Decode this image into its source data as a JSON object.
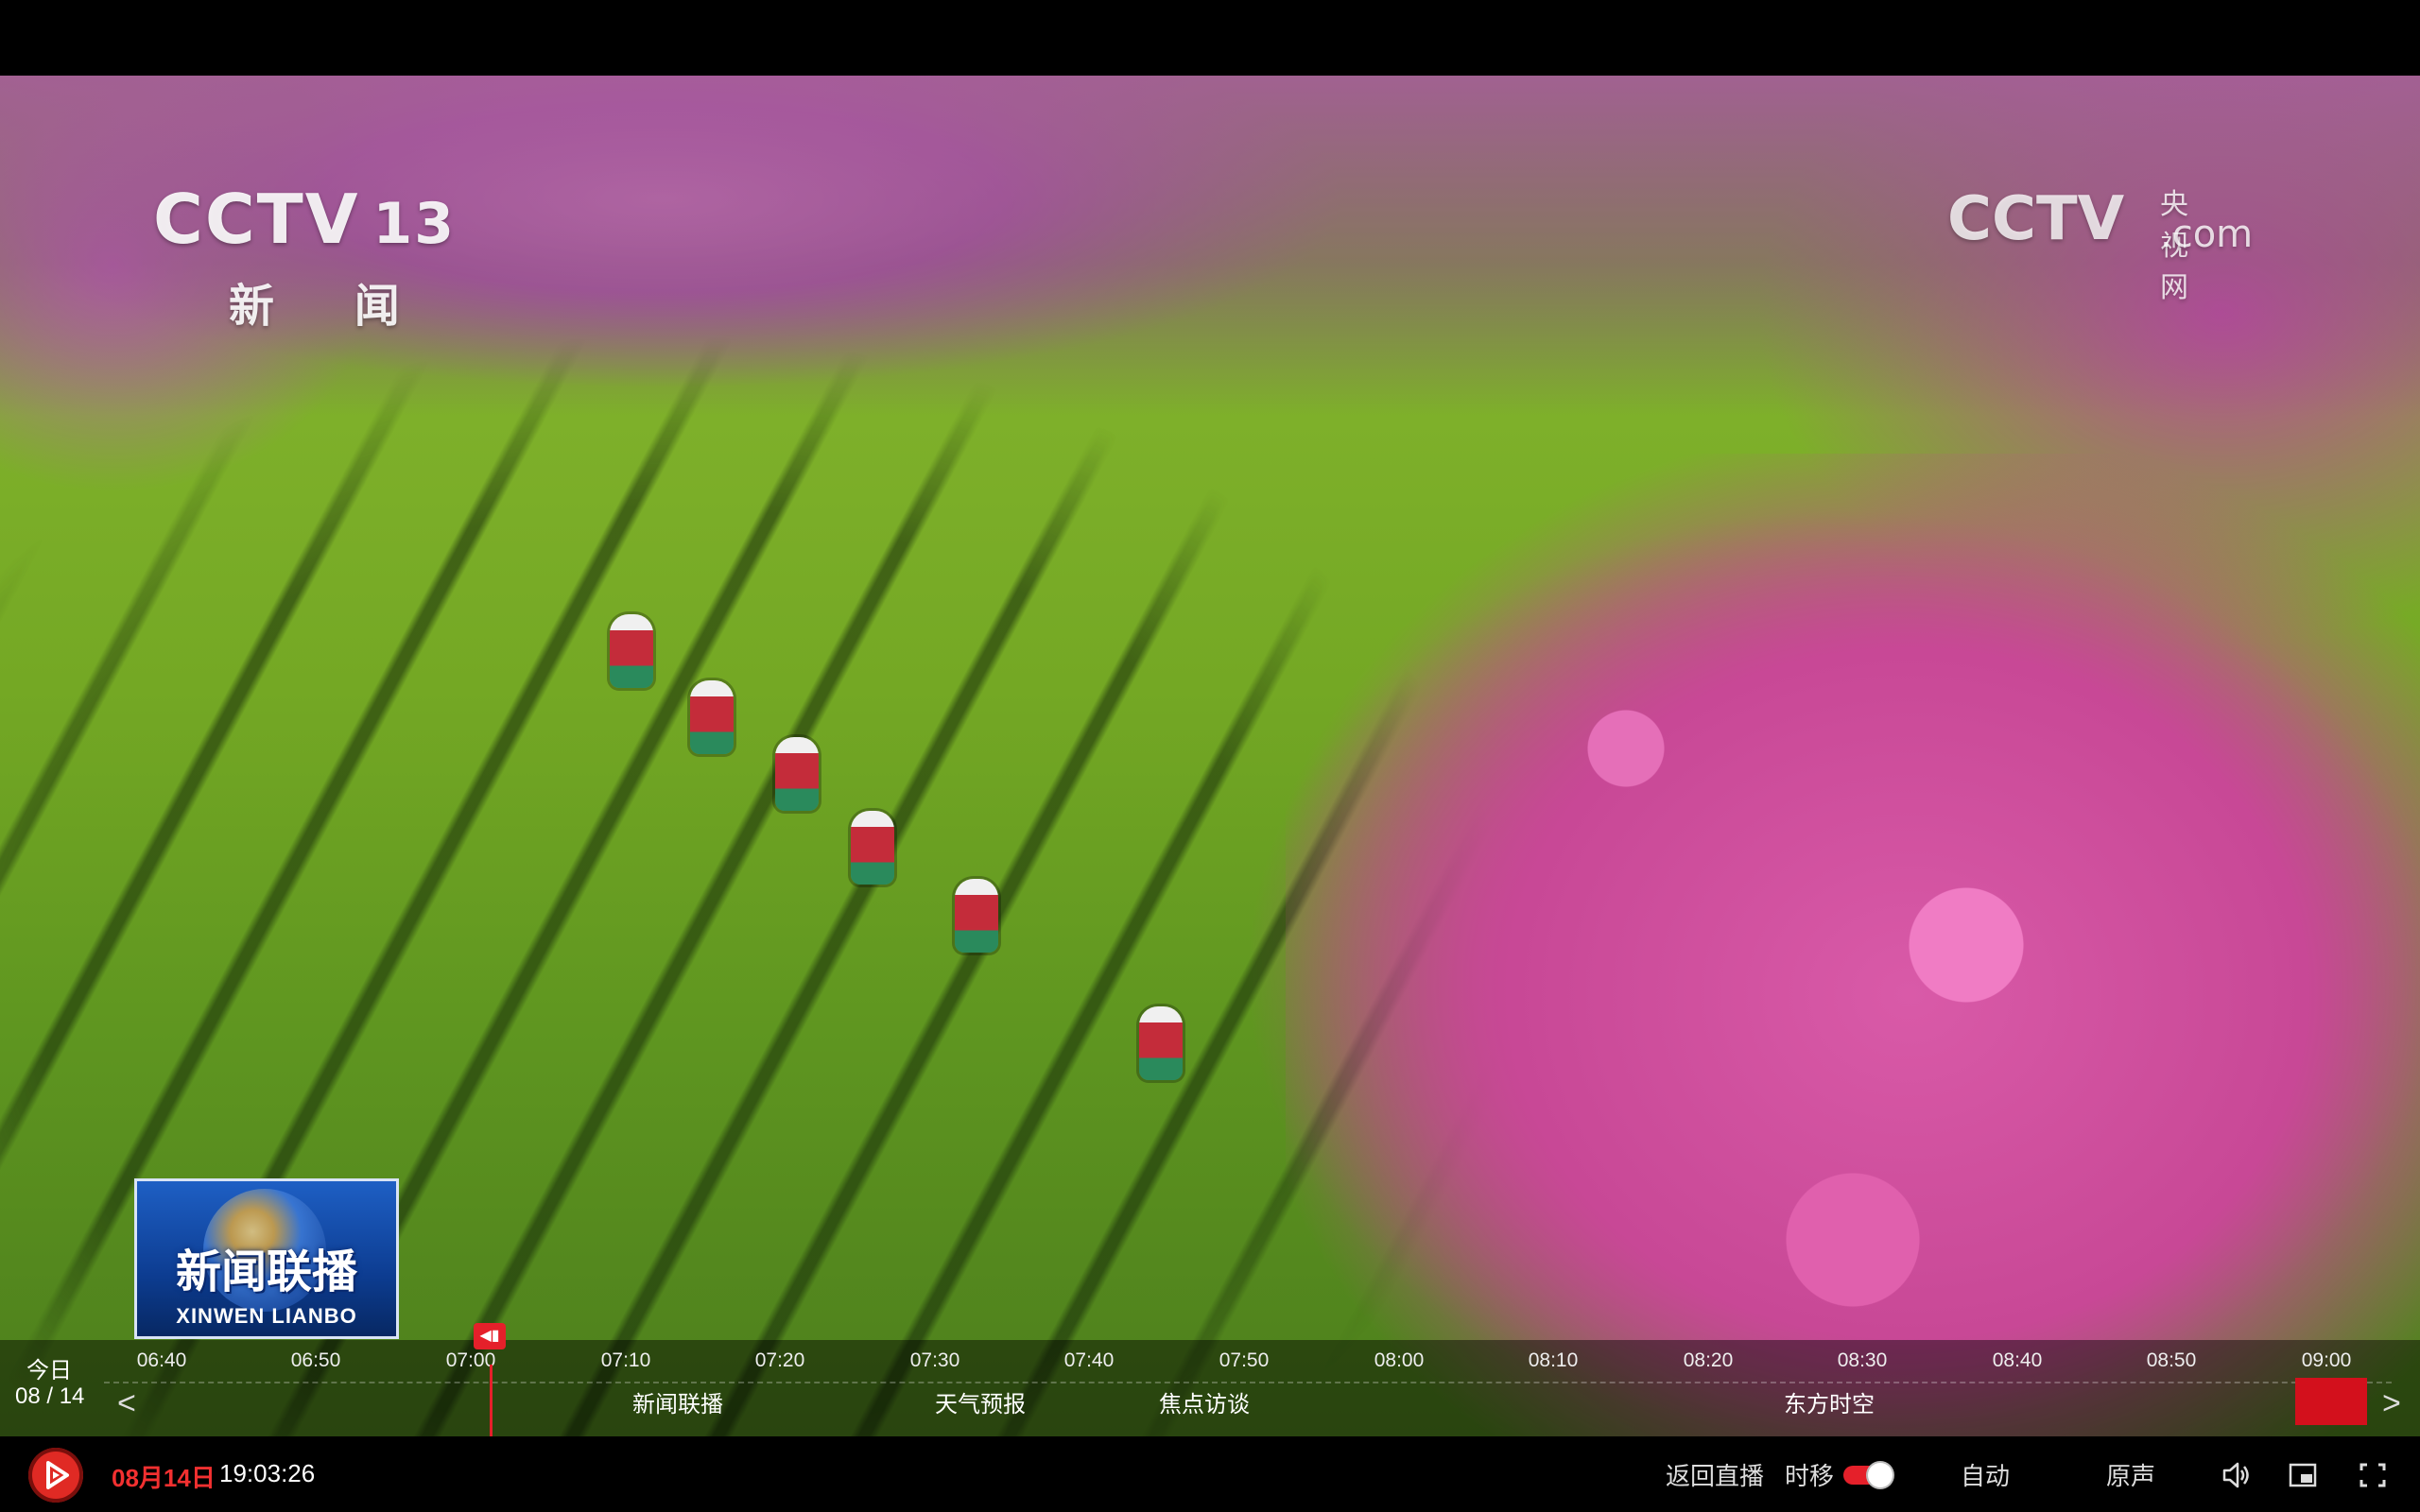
{
  "overlay": {
    "channel_logo": {
      "brand": "CCTV",
      "number": "13",
      "name": "新 闻"
    },
    "watermark": {
      "brand": "CCTV",
      "cn": "央视网",
      "suffix": ".com"
    },
    "program_logo": {
      "cn": "新闻联播",
      "en": "XINWEN LIANBO"
    }
  },
  "epg": {
    "today_label": "今日",
    "date": "08 / 14",
    "ticks": [
      "06:40",
      "06:50",
      "07:00",
      "07:10",
      "07:20",
      "07:30",
      "07:40",
      "07:50",
      "08:00",
      "08:10",
      "08:20",
      "08:30",
      "08:40",
      "08:50",
      "09:00"
    ],
    "programs": [
      {
        "title": "新闻联播"
      },
      {
        "title": "天气预报"
      },
      {
        "title": "焦点访谈"
      },
      {
        "title": "东方时空"
      }
    ],
    "prev_glyph": "<",
    "next_glyph": ">",
    "playhead_label": "◀▮"
  },
  "controls": {
    "date": "08月14日",
    "time": "19:03:26",
    "back_to_live": "返回直播",
    "timeshift": "时移",
    "timeshift_on": true,
    "quality": "自动",
    "audio": "原声",
    "icons": [
      "play-icon",
      "volume-icon",
      "pip-icon",
      "fullscreen-icon"
    ],
    "accent_color": "#e5202a"
  }
}
